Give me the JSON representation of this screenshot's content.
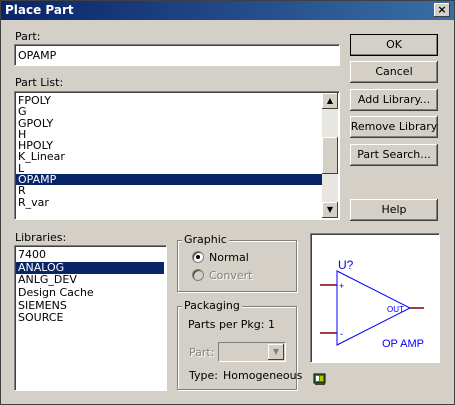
{
  "window": {
    "title": "Place Part",
    "close_glyph": "×"
  },
  "part": {
    "label": "Part:",
    "value": "OPAMP"
  },
  "part_list": {
    "label": "Part List:",
    "items": [
      "FPOLY",
      "G",
      "GPOLY",
      "H",
      "HPOLY",
      "K_Linear",
      "L",
      "OPAMP",
      "R",
      "R_var"
    ],
    "selected": "OPAMP"
  },
  "libraries": {
    "label": "Libraries:",
    "items": [
      "7400",
      "ANALOG",
      "ANLG_DEV",
      "Design Cache",
      "SIEMENS",
      "SOURCE"
    ],
    "selected": "ANALOG"
  },
  "buttons": {
    "ok": "OK",
    "cancel": "Cancel",
    "add_library": "Add Library...",
    "remove_library": "Remove Library",
    "part_search": "Part Search...",
    "help": "Help"
  },
  "graphic": {
    "title": "Graphic",
    "normal": "Normal",
    "convert": "Convert",
    "selected": "Normal"
  },
  "packaging": {
    "title": "Packaging",
    "parts_per_pkg_label": "Parts per Pkg:",
    "parts_per_pkg_value": "1",
    "part_label": "Part:",
    "type_label": "Type:",
    "type_value": "Homogeneous"
  },
  "preview": {
    "refdes": "U?",
    "plus": "+",
    "minus": "-",
    "out": "OUT",
    "name": "OP AMP",
    "pin_color": "#800000",
    "body_color": "#0000ff"
  }
}
